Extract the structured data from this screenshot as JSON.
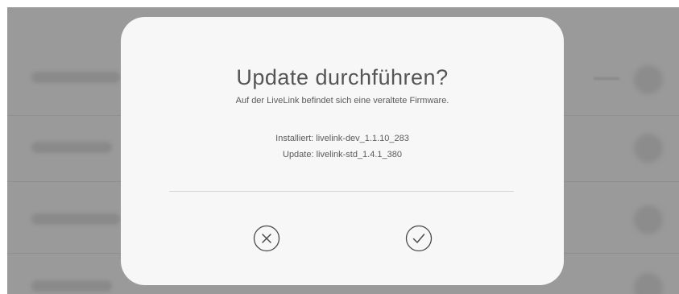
{
  "dialog": {
    "title": "Update durchführen?",
    "message": "Auf der LiveLink befindet sich eine veraltete Firmware.",
    "installed": "Installiert: livelink-dev_1.1.10_283",
    "update": "Update: livelink-std_1.4.1_380",
    "actions": {
      "cancel_icon": "close-circle-icon",
      "confirm_icon": "check-circle-icon"
    }
  },
  "colors": {
    "overlay": "#9a9a9a",
    "dialog_background": "#f7f7f7",
    "text": "#555555",
    "divider": "#d6d6d6"
  }
}
